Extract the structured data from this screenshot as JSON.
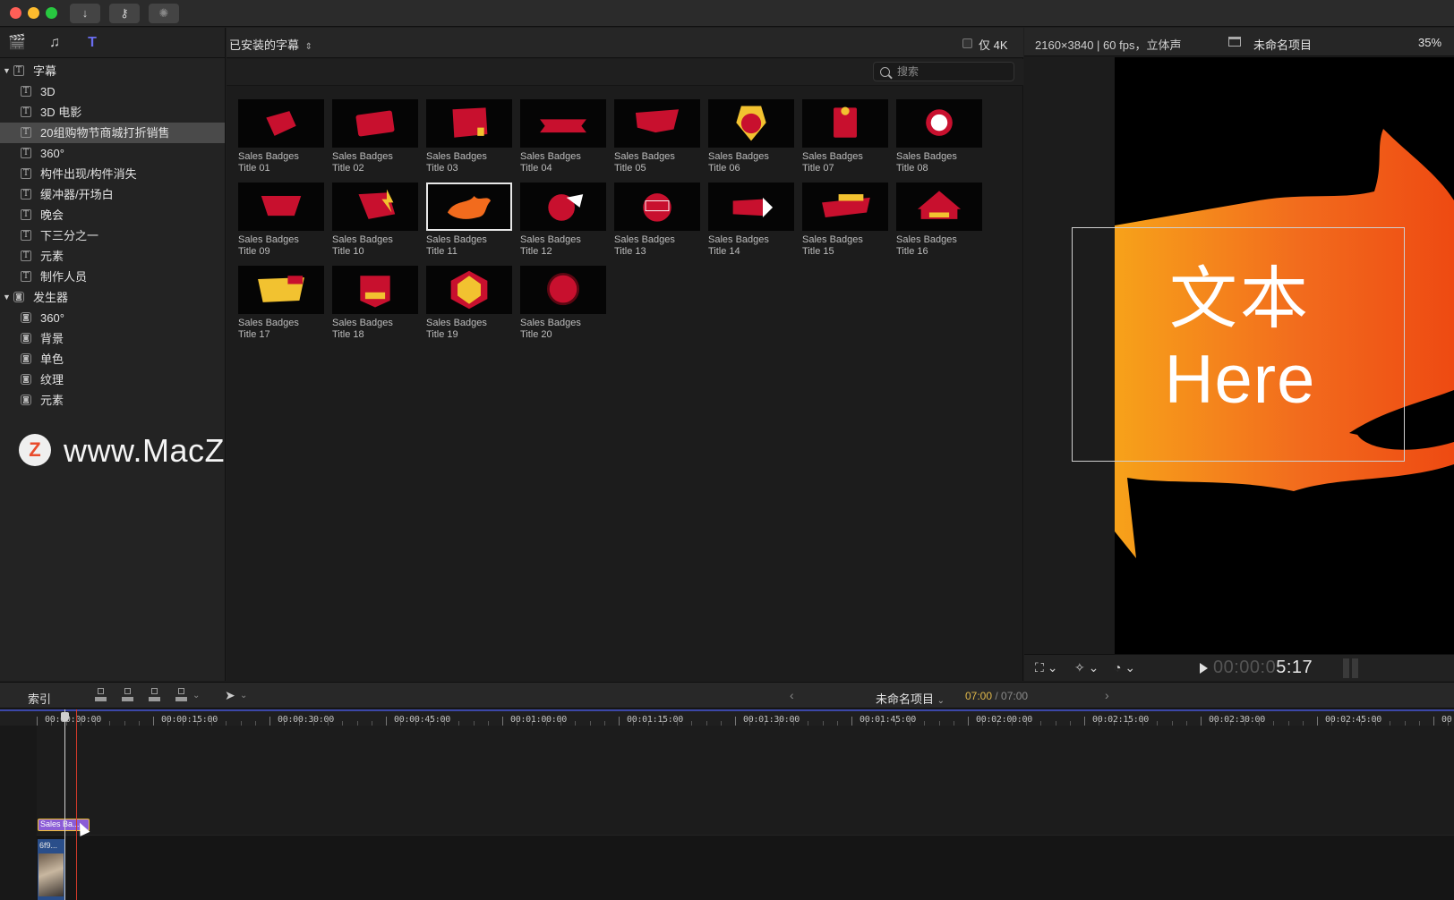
{
  "toolbar": {
    "download_icon": "download-arrow-icon",
    "key_icon": "key-icon",
    "activity_icon": "spinner-icon"
  },
  "sidebar": {
    "header_icons": [
      "clapper-icon",
      "music-photo-icon",
      "titles-generators-icon"
    ],
    "sections": [
      {
        "label": "字幕",
        "expanded": true,
        "items": [
          "3D",
          "3D 电影",
          "20组购物节商城打折销售",
          "360°",
          "构件出现/构件消失",
          "缓冲器/开场白",
          "晚会",
          "下三分之一",
          "元素",
          "制作人员"
        ]
      },
      {
        "label": "发生器",
        "expanded": true,
        "items": [
          "360°",
          "背景",
          "单色",
          "纹理",
          "元素"
        ]
      }
    ],
    "selected_item": "20组购物节商城打折销售"
  },
  "watermark": {
    "logo": "Z",
    "text": "www.MacZ.com"
  },
  "browser": {
    "title": "已安装的字幕",
    "only_4k_label": "仅 4K",
    "only_4k_checked": false,
    "search": {
      "placeholder": "搜索",
      "value": ""
    },
    "items": [
      {
        "name_line1": "Sales Badges",
        "name_line2": "Title 01"
      },
      {
        "name_line1": "Sales Badges",
        "name_line2": "Title 02"
      },
      {
        "name_line1": "Sales Badges",
        "name_line2": "Title 03"
      },
      {
        "name_line1": "Sales Badges",
        "name_line2": "Title 04"
      },
      {
        "name_line1": "Sales Badges",
        "name_line2": "Title 05"
      },
      {
        "name_line1": "Sales Badges",
        "name_line2": "Title 06"
      },
      {
        "name_line1": "Sales Badges",
        "name_line2": "Title 07"
      },
      {
        "name_line1": "Sales Badges",
        "name_line2": "Title 08"
      },
      {
        "name_line1": "Sales Badges",
        "name_line2": "Title 09"
      },
      {
        "name_line1": "Sales Badges",
        "name_line2": "Title 10"
      },
      {
        "name_line1": "Sales Badges",
        "name_line2": "Title 11"
      },
      {
        "name_line1": "Sales Badges",
        "name_line2": "Title 12"
      },
      {
        "name_line1": "Sales Badges",
        "name_line2": "Title 13"
      },
      {
        "name_line1": "Sales Badges",
        "name_line2": "Title 14"
      },
      {
        "name_line1": "Sales Badges",
        "name_line2": "Title 15"
      },
      {
        "name_line1": "Sales Badges",
        "name_line2": "Title 16"
      },
      {
        "name_line1": "Sales Badges",
        "name_line2": "Title 17"
      },
      {
        "name_line1": "Sales Badges",
        "name_line2": "Title 18"
      },
      {
        "name_line1": "Sales Badges",
        "name_line2": "Title 19"
      },
      {
        "name_line1": "Sales Badges",
        "name_line2": "Title 20"
      }
    ],
    "selected_index": 10
  },
  "viewer": {
    "format": "2160×3840 | 60 fps，立体声",
    "project": "未命名项目",
    "zoom": "35%",
    "overlay_line1": "文本",
    "overlay_line2": "Here",
    "timecode_dim": "00:00:0",
    "timecode_bright": "5:17"
  },
  "timeline": {
    "index_label": "索引",
    "project": "未命名项目",
    "time_current": "07:00",
    "time_total": "/ 07:00",
    "ruler_labels": [
      "00:00:00:00",
      "00:00:15:00",
      "00:00:30:00",
      "00:00:45:00",
      "00:01:00:00",
      "00:01:15:00",
      "00:01:30:00",
      "00:01:45:00",
      "00:02:00:00",
      "00:02:15:00",
      "00:02:30:00",
      "00:02:45:00",
      "00"
    ],
    "title_clip": "Sales Ba...",
    "video_clip": "6f9..."
  },
  "colors": {
    "accent_purple": "#8b5cd6",
    "clip_selected": "#f2c230",
    "badge_red": "#c8102e",
    "badge_yellow": "#f2c230",
    "flame_orange": "#f26b1d"
  }
}
